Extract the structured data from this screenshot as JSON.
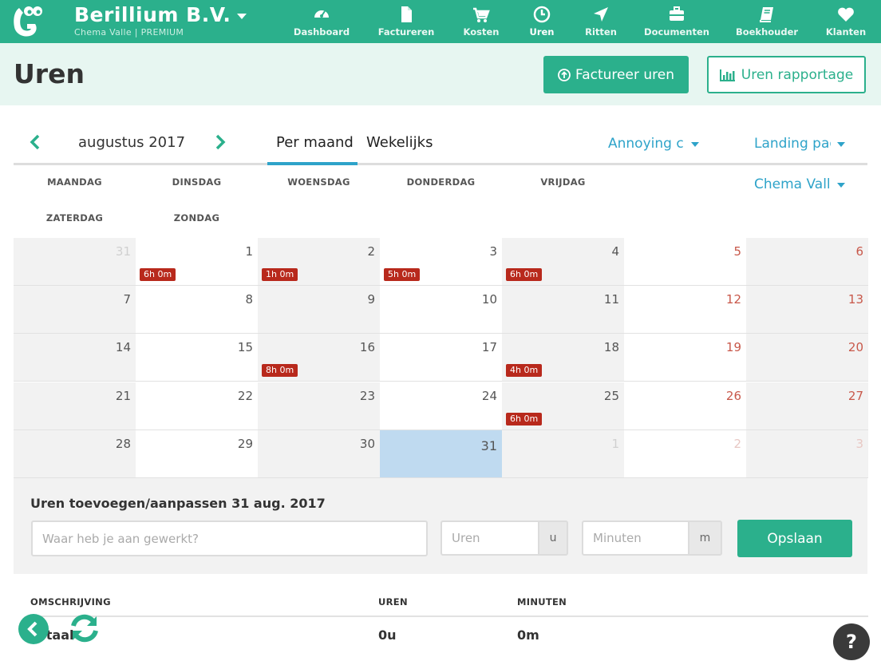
{
  "header": {
    "company": "Berillium B.V.",
    "subtitle": "Chema Valle | PREMIUM",
    "nav": [
      {
        "label": "Dashboard",
        "icon": "speedometer-icon"
      },
      {
        "label": "Factureren",
        "icon": "document-icon"
      },
      {
        "label": "Kosten",
        "icon": "cart-icon"
      },
      {
        "label": "Uren",
        "icon": "clock-icon",
        "active": true
      },
      {
        "label": "Ritten",
        "icon": "location-arrow-icon"
      },
      {
        "label": "Documenten",
        "icon": "briefcase-icon"
      },
      {
        "label": "Boekhouder",
        "icon": "book-icon"
      },
      {
        "label": "Klanten",
        "icon": "heart-icon"
      }
    ]
  },
  "page": {
    "title": "Uren",
    "invoice_button": "Factureer uren",
    "report_button": "Uren rapportage"
  },
  "calendar": {
    "month_label": "augustus 2017",
    "tabs": [
      "Per maand",
      "Wekelijks"
    ],
    "active_tab": "Per maand",
    "filters": {
      "customer": "Annoying cu",
      "project": "Landing pag",
      "user": "Chema Valle"
    },
    "weekdays": [
      "MAANDAG",
      "DINSDAG",
      "WOENSDAG",
      "DONDERDAG",
      "VRIJDAG",
      "ZATERDAG",
      "ZONDAG"
    ],
    "weeks": [
      [
        {
          "d": "31",
          "other": true
        },
        {
          "d": "1",
          "h": "6h 0m"
        },
        {
          "d": "2",
          "h": "1h 0m"
        },
        {
          "d": "3",
          "h": "5h 0m"
        },
        {
          "d": "4",
          "h": "6h 0m"
        },
        {
          "d": "5"
        },
        {
          "d": "6"
        }
      ],
      [
        {
          "d": "7"
        },
        {
          "d": "8"
        },
        {
          "d": "9"
        },
        {
          "d": "10"
        },
        {
          "d": "11"
        },
        {
          "d": "12"
        },
        {
          "d": "13"
        }
      ],
      [
        {
          "d": "14"
        },
        {
          "d": "15"
        },
        {
          "d": "16",
          "h": "8h 0m"
        },
        {
          "d": "17"
        },
        {
          "d": "18",
          "h": "4h 0m"
        },
        {
          "d": "19"
        },
        {
          "d": "20"
        }
      ],
      [
        {
          "d": "21"
        },
        {
          "d": "22"
        },
        {
          "d": "23"
        },
        {
          "d": "24"
        },
        {
          "d": "25",
          "h": "6h 0m"
        },
        {
          "d": "26"
        },
        {
          "d": "27"
        }
      ],
      [
        {
          "d": "28"
        },
        {
          "d": "29"
        },
        {
          "d": "30"
        },
        {
          "d": "31",
          "today": true
        },
        {
          "d": "1",
          "other": true
        },
        {
          "d": "2",
          "other": true
        },
        {
          "d": "3",
          "other": true
        }
      ]
    ]
  },
  "form": {
    "title": "Uren toevoegen/aanpassen 31 aug. 2017",
    "description_placeholder": "Waar heb je aan gewerkt?",
    "hours_placeholder": "Uren",
    "hours_unit": "u",
    "minutes_placeholder": "Minuten",
    "minutes_unit": "m",
    "save_label": "Opslaan"
  },
  "summary": {
    "headers": {
      "description": "OMSCHRIJVING",
      "hours": "UREN",
      "minutes": "MINUTEN"
    },
    "total_label": "Totaal",
    "total_hours": "0u",
    "total_minutes": "0m"
  },
  "help_label": "?",
  "colors": {
    "brand": "#2bb08c",
    "link": "#2ea3c9",
    "badge": "#b8291c",
    "weekend": "#c8584a",
    "today": "#bfdaf0"
  }
}
